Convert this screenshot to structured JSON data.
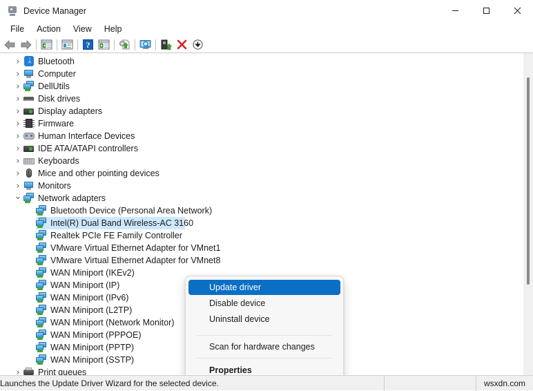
{
  "window": {
    "title": "Device Manager",
    "app_icon": "device-manager-icon",
    "controls": {
      "minimize": "minimize",
      "maximize": "maximize",
      "close": "close"
    }
  },
  "menubar": {
    "items": [
      {
        "label": "File"
      },
      {
        "label": "Action"
      },
      {
        "label": "View"
      },
      {
        "label": "Help"
      }
    ]
  },
  "toolbar": {
    "buttons": [
      {
        "name": "back-arrow-icon",
        "tip": "Back"
      },
      {
        "name": "forward-arrow-icon",
        "tip": "Forward"
      },
      {
        "name": "show-hide-console-tree-icon",
        "tip": "Show/Hide Console Tree"
      },
      {
        "name": "properties-icon",
        "tip": "Properties"
      },
      {
        "name": "help-icon",
        "tip": "Help"
      },
      {
        "name": "action-pane-icon",
        "tip": "Show/Hide Action Pane"
      },
      {
        "name": "update-driver-icon",
        "tip": "Update Driver Software"
      },
      {
        "name": "scan-hardware-changes-icon",
        "tip": "Scan for hardware changes"
      },
      {
        "name": "enable-device-icon",
        "tip": "Enable device"
      },
      {
        "name": "uninstall-device-icon",
        "tip": "Uninstall device"
      },
      {
        "name": "download-icon",
        "tip": "Download"
      }
    ]
  },
  "tree": {
    "nodes": [
      {
        "label": "Bluetooth",
        "icon": "bluetooth-icon",
        "level": 1,
        "expander": "collapsed"
      },
      {
        "label": "Computer",
        "icon": "computer-icon",
        "level": 1,
        "expander": "collapsed"
      },
      {
        "label": "DellUtils",
        "icon": "network-icon",
        "level": 1,
        "expander": "collapsed"
      },
      {
        "label": "Disk drives",
        "icon": "disk-drive-icon",
        "level": 1,
        "expander": "collapsed"
      },
      {
        "label": "Display adapters",
        "icon": "display-adapter-icon",
        "level": 1,
        "expander": "collapsed"
      },
      {
        "label": "Firmware",
        "icon": "firmware-chip-icon",
        "level": 1,
        "expander": "collapsed"
      },
      {
        "label": "Human Interface Devices",
        "icon": "hid-icon",
        "level": 1,
        "expander": "collapsed"
      },
      {
        "label": "IDE ATA/ATAPI controllers",
        "icon": "ide-controller-icon",
        "level": 1,
        "expander": "collapsed"
      },
      {
        "label": "Keyboards",
        "icon": "keyboard-icon",
        "level": 1,
        "expander": "collapsed"
      },
      {
        "label": "Mice and other pointing devices",
        "icon": "mouse-icon",
        "level": 1,
        "expander": "collapsed"
      },
      {
        "label": "Monitors",
        "icon": "monitor-icon",
        "level": 1,
        "expander": "collapsed"
      },
      {
        "label": "Network adapters",
        "icon": "network-icon",
        "level": 1,
        "expander": "expanded"
      },
      {
        "label": "Bluetooth Device (Personal Area Network)",
        "icon": "network-adapter-icon",
        "level": 2,
        "expander": "none"
      },
      {
        "label": "Intel(R) Dual Band Wireless-AC 3160",
        "icon": "network-adapter-icon",
        "level": 2,
        "expander": "none",
        "selected": true
      },
      {
        "label": "Realtek PCIe FE Family Controller",
        "icon": "network-adapter-icon",
        "level": 2,
        "expander": "none"
      },
      {
        "label": "VMware Virtual Ethernet Adapter for VMnet1",
        "icon": "network-adapter-icon",
        "level": 2,
        "expander": "none"
      },
      {
        "label": "VMware Virtual Ethernet Adapter for VMnet8",
        "icon": "network-adapter-icon",
        "level": 2,
        "expander": "none"
      },
      {
        "label": "WAN Miniport (IKEv2)",
        "icon": "network-adapter-icon",
        "level": 2,
        "expander": "none"
      },
      {
        "label": "WAN Miniport (IP)",
        "icon": "network-adapter-icon",
        "level": 2,
        "expander": "none"
      },
      {
        "label": "WAN Miniport (IPv6)",
        "icon": "network-adapter-icon",
        "level": 2,
        "expander": "none"
      },
      {
        "label": "WAN Miniport (L2TP)",
        "icon": "network-adapter-icon",
        "level": 2,
        "expander": "none"
      },
      {
        "label": "WAN Miniport (Network Monitor)",
        "icon": "network-adapter-icon",
        "level": 2,
        "expander": "none"
      },
      {
        "label": "WAN Miniport (PPPOE)",
        "icon": "network-adapter-icon",
        "level": 2,
        "expander": "none"
      },
      {
        "label": "WAN Miniport (PPTP)",
        "icon": "network-adapter-icon",
        "level": 2,
        "expander": "none"
      },
      {
        "label": "WAN Miniport (SSTP)",
        "icon": "network-adapter-icon",
        "level": 2,
        "expander": "none"
      },
      {
        "label": "Print queues",
        "icon": "print-queue-icon",
        "level": 1,
        "expander": "collapsed"
      }
    ]
  },
  "context_menu": {
    "items": [
      {
        "label": "Update driver",
        "highlighted": true,
        "type": "item"
      },
      {
        "label": "Disable device",
        "type": "item"
      },
      {
        "label": "Uninstall device",
        "type": "item"
      },
      {
        "type": "separator"
      },
      {
        "label": "Scan for hardware changes",
        "type": "item"
      },
      {
        "type": "separator"
      },
      {
        "label": "Properties",
        "type": "item",
        "bold": true
      }
    ],
    "highlight_color": "#0b6fc4"
  },
  "statusbar": {
    "message": "Launches the Update Driver Wizard for the selected device.",
    "middle": "",
    "watermark": "wsxdn.com"
  }
}
